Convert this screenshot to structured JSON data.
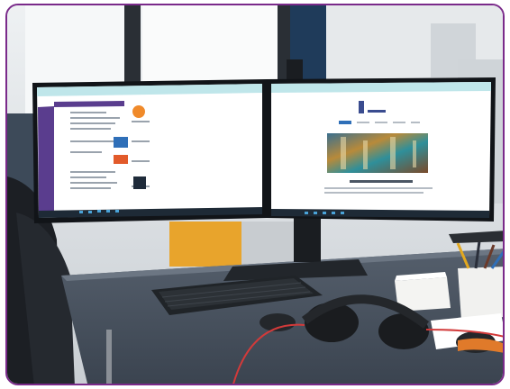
{
  "photo": {
    "subject": "dual-monitor-workstation",
    "border_color": "#7a2a8a"
  },
  "monitor_left": {
    "screen": "web-page-with-purple-sidebar"
  },
  "monitor_right": {
    "screen": "web-page-with-hero-image"
  },
  "colors": {
    "sidebar_purple": "#5a3d8e",
    "browser_bar": "#bfe6ea",
    "taskbar": "#1e2a36",
    "desk": "#46505e",
    "headphone_red": "#d23a3a"
  }
}
